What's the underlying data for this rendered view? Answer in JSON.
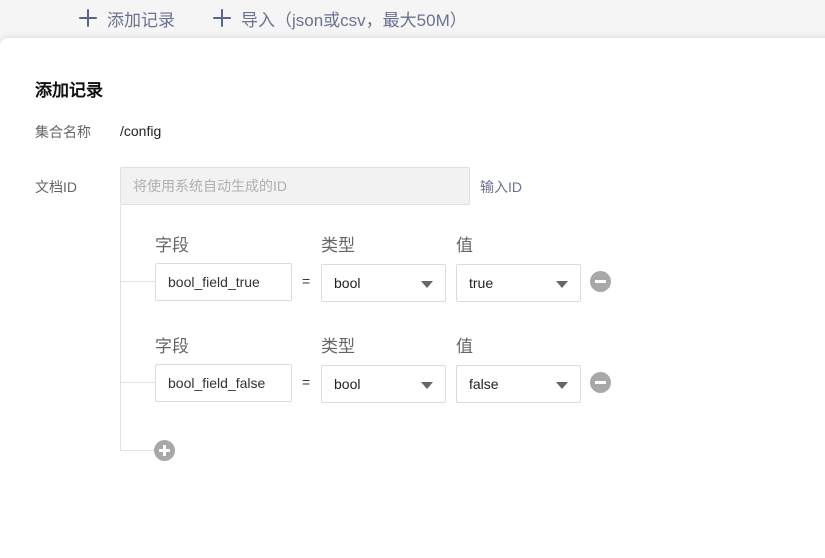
{
  "toolbar": {
    "add_record_label": "添加记录",
    "import_label": "导入（json或csv，最大50M）"
  },
  "dialog": {
    "title": "添加记录",
    "collection_label": "集合名称",
    "collection_value": "/config",
    "doc_id_label": "文档ID",
    "doc_id_placeholder": "将使用系统自动生成的ID",
    "input_id_link": "输入ID"
  },
  "columns": {
    "field": "字段",
    "type": "类型",
    "value": "值"
  },
  "rows": [
    {
      "field": "bool_field_true",
      "eq": "=",
      "type": "bool",
      "value": "true"
    },
    {
      "field": "bool_field_false",
      "eq": "=",
      "type": "bool",
      "value": "false"
    }
  ],
  "icons": {
    "toolbar_add": "plus-icon",
    "toolbar_import": "plus-icon",
    "remove_row": "minus-circle-icon",
    "add_row": "plus-circle-icon",
    "select_caret": "caret-down-icon"
  },
  "colors": {
    "accent": "#6b7290",
    "round_button": "#a8a8a8"
  }
}
